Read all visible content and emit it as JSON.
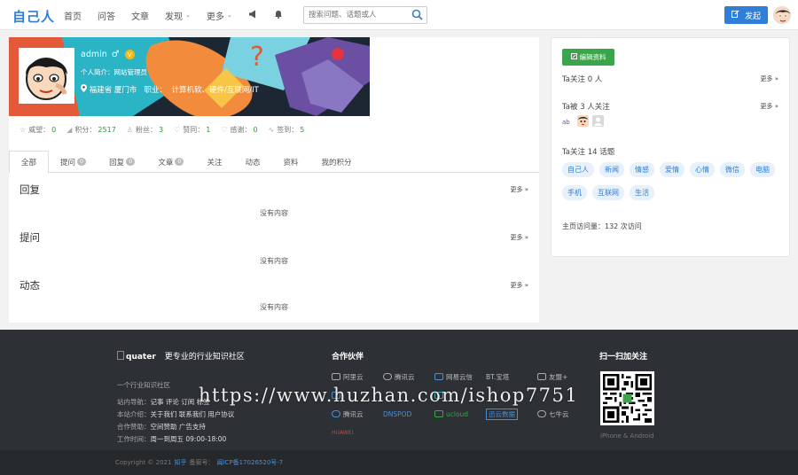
{
  "header": {
    "logo": "自己人",
    "nav": [
      {
        "label": "首页"
      },
      {
        "label": "问答"
      },
      {
        "label": "文章"
      },
      {
        "label": "发现",
        "caret": "⌄"
      },
      {
        "label": "更多",
        "caret": "⌄"
      }
    ],
    "search_placeholder": "搜索问题、话题或人",
    "post_label": "发起"
  },
  "profile": {
    "username": "admin",
    "gender": "♂",
    "vip": "V",
    "bio": "个人简介：网站管理员",
    "location": "福建省 厦门市",
    "job_label": "职业：",
    "job": "计算机软、硬件/互联网/IT"
  },
  "stats": [
    {
      "icon": "☆",
      "label": "威望：",
      "value": "0"
    },
    {
      "icon": "◢",
      "label": "积分：",
      "value": "2517"
    },
    {
      "icon": "♙",
      "label": "粉丝：",
      "value": "3"
    },
    {
      "icon": "♡",
      "label": "赞同：",
      "value": "1"
    },
    {
      "icon": "♡",
      "label": "感谢：",
      "value": "0"
    },
    {
      "icon": "∿",
      "label": "签到：",
      "value": "5"
    }
  ],
  "tabs": [
    {
      "label": "全部",
      "count": ""
    },
    {
      "label": "提问",
      "count": "0"
    },
    {
      "label": "回复",
      "count": "0"
    },
    {
      "label": "文章",
      "count": "0"
    },
    {
      "label": "关注",
      "count": ""
    },
    {
      "label": "动态",
      "count": ""
    },
    {
      "label": "资料",
      "count": ""
    },
    {
      "label": "我的积分",
      "count": ""
    }
  ],
  "sections": [
    {
      "title": "回复",
      "more": "更多 »",
      "empty": "没有内容"
    },
    {
      "title": "提问",
      "more": "更多 »",
      "empty": "没有内容"
    },
    {
      "title": "动态",
      "more": "更多 »",
      "empty": "没有内容"
    }
  ],
  "sidebar": {
    "edit_label": "编辑资料",
    "following_users": "Ta关注 0 人",
    "followers": "Ta被 3 人关注",
    "following_topics": "Ta关注 14 话题",
    "more": "更多 »",
    "topics": [
      "自己人",
      "新闻",
      "情感",
      "爱情",
      "心情",
      "微信",
      "电脑",
      "手机",
      "互联网",
      "生活"
    ],
    "visits": "主页访问量：132 次访问"
  },
  "footer": {
    "logo": "quater",
    "slogan": "更专业的行业知识社区",
    "intro": "一个行业知识社区",
    "nav_label": "站内导航：",
    "nav_links": "记事 评论 订阅 标签",
    "about_label": "本站介绍：",
    "about_links": "关于我们 联系我们 用户协议",
    "sponsor_label": "合作赞助：",
    "sponsor_links": "空间赞助 广告支持",
    "hours_label": "工作时间：",
    "hours": "周一到周五 09:00-18:00",
    "partner_title": "合作伙伴",
    "partners": [
      "阿里云",
      "腾讯云",
      "网易云信",
      "BT.宝塔",
      "友盟+",
      "",
      "",
      "",
      "",
      "",
      "腾讯云",
      "DNSPOD",
      "ucloud",
      "迅云数据",
      "七牛云",
      "HUAWEI",
      "",
      "",
      "",
      ""
    ],
    "qr_title": "扫一扫加关注",
    "qr_caption": "iPhone & Android",
    "copyright": "Copyright © 2021",
    "copyright_site": "知乎",
    "icp_label": "备案号：",
    "icp": "闽ICP备17026520号-7"
  },
  "watermark": "https://www.huzhan.com/ishop7751",
  "colors": {
    "accent": "#2f7fd8",
    "green": "#3aa54a",
    "stat_value": "#2a9d3e",
    "footer_bg": "#2d3034"
  }
}
